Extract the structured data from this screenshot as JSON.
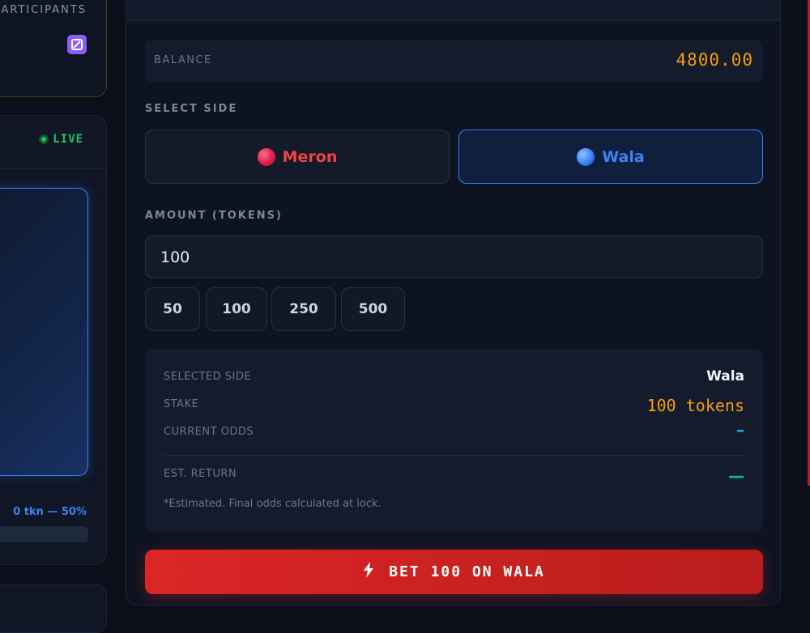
{
  "left": {
    "participants_label": "PARTICIPANTS",
    "live_label": "LIVE",
    "pool_text": "0 tkn — 50%"
  },
  "balance": {
    "label": "BALANCE",
    "value": "4800.00"
  },
  "select_side": {
    "label": "SELECT SIDE",
    "options": [
      {
        "label": "Meron",
        "color": "#ef4444"
      },
      {
        "label": "Wala",
        "color": "#3b82f6"
      }
    ],
    "selected": "Wala"
  },
  "amount": {
    "label": "AMOUNT (TOKENS)",
    "value": "100",
    "chips": [
      "50",
      "100",
      "250",
      "500"
    ]
  },
  "summary": {
    "selected_side_label": "SELECTED SIDE",
    "selected_side_value": "Wala",
    "stake_label": "STAKE",
    "stake_value": "100 tokens",
    "odds_label": "CURRENT ODDS",
    "odds_value": "–",
    "return_label": "EST. RETURN",
    "return_value": "—",
    "note": "*Estimated. Final odds calculated at lock."
  },
  "bet_button": {
    "label": "BET 100 ON WALA",
    "icon": "lightning-icon"
  },
  "colors": {
    "accent_gold": "#f59e0b",
    "accent_blue": "#3b82f6",
    "accent_red": "#dc2626",
    "live_green": "#22c55e"
  }
}
